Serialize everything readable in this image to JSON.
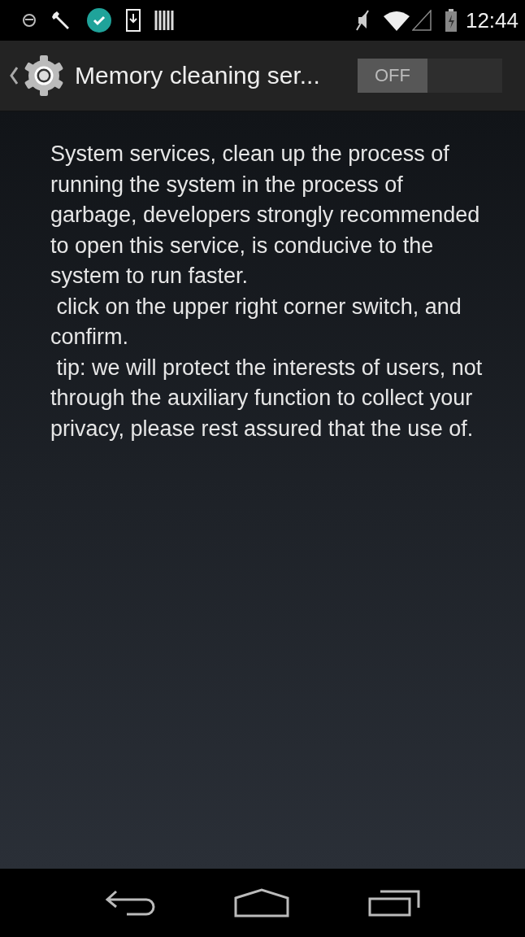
{
  "status_bar": {
    "time": "12:44"
  },
  "action_bar": {
    "title": "Memory cleaning ser...",
    "switch": {
      "label": "OFF",
      "on": false
    }
  },
  "paragraphs": [
    "System services, clean up the process of running the system in the process of garbage, developers strongly recommended to open this service, is conducive to the system to run faster.",
    " click on the upper right corner switch, and confirm.",
    " tip: we will protect the interests of users, not through the auxiliary function to collect your privacy, please rest assured that the use of."
  ]
}
